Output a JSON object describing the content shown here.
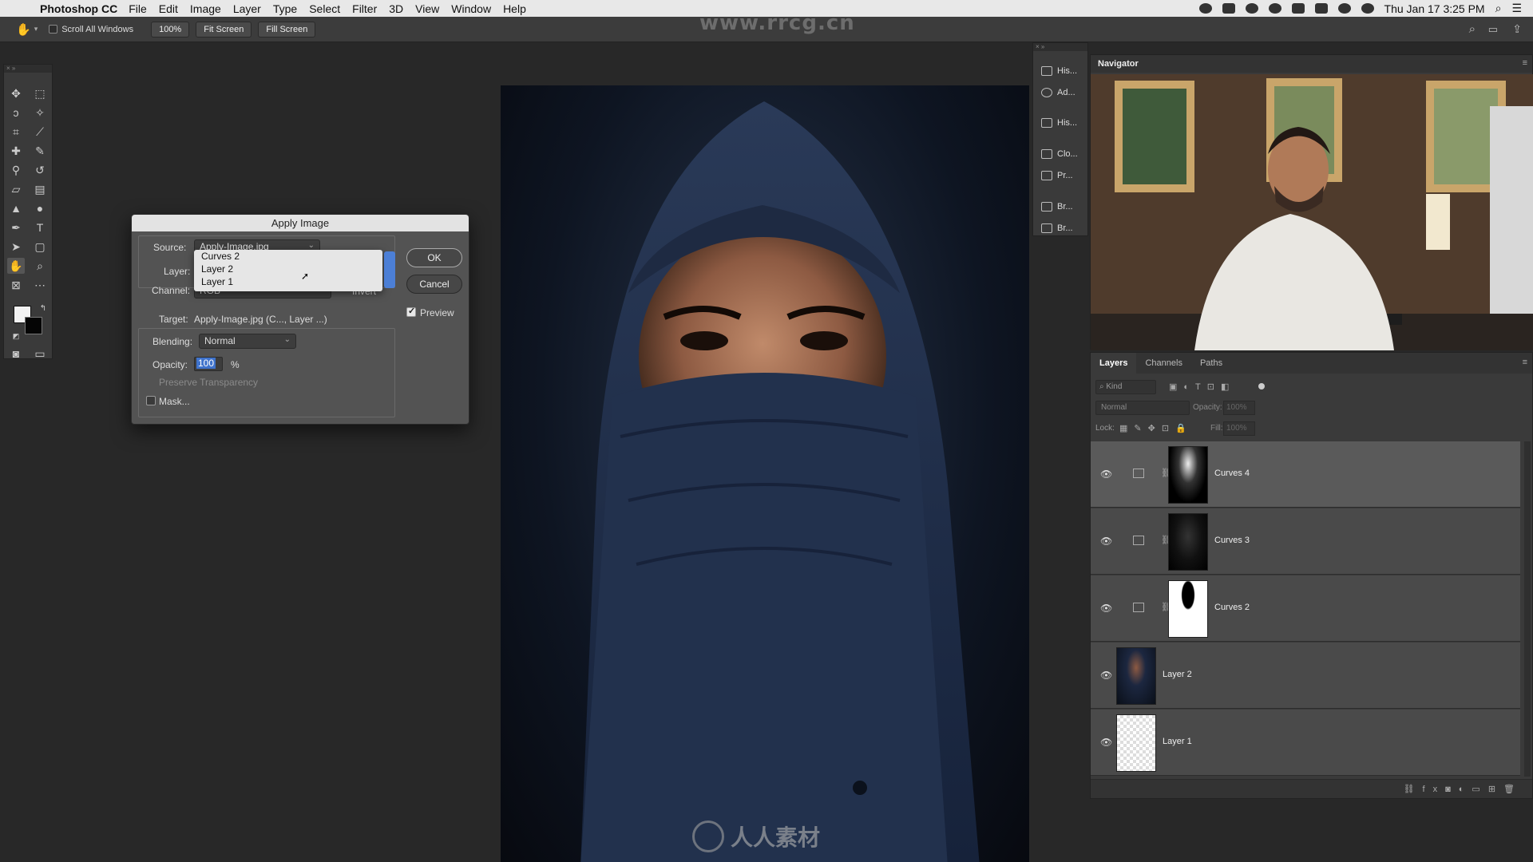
{
  "menubar": {
    "apple": "",
    "app_name": "Photoshop CC",
    "items": [
      "File",
      "Edit",
      "Image",
      "Layer",
      "Type",
      "Select",
      "Filter",
      "3D",
      "View",
      "Window",
      "Help"
    ],
    "clock": "Thu Jan 17  3:25 PM"
  },
  "options_bar": {
    "scroll_all_windows": "Scroll All Windows",
    "zoom": "100%",
    "fit_screen": "Fit Screen",
    "fill_screen": "Fill Screen"
  },
  "watermark": {
    "top": "www.rrcg.cn",
    "bottom": "人人素材"
  },
  "apply_image": {
    "title": "Apply Image",
    "source_label": "Source:",
    "source_value": "Apply-Image.jpg",
    "layer_label": "Layer:",
    "channel_label": "Channel:",
    "channel_value": "RGB",
    "invert_label": "Invert",
    "target_label": "Target:",
    "target_value": "Apply-Image.jpg (C..., Layer ...)",
    "blending_label": "Blending:",
    "blending_value": "Normal",
    "opacity_label": "Opacity:",
    "opacity_value": "100",
    "opacity_unit": "%",
    "preserve_label": "Preserve Transparency",
    "mask_label": "Mask...",
    "ok_label": "OK",
    "cancel_label": "Cancel",
    "preview_label": "Preview",
    "layer_options": [
      "Curves 2",
      "Layer 2",
      "Layer 1"
    ]
  },
  "mini_panel": {
    "items": [
      "His...",
      "Ad...",
      "His...",
      "Clo...",
      "Pr...",
      "Br...",
      "Br..."
    ]
  },
  "navigator": {
    "title": "Navigator"
  },
  "layers_panel": {
    "tabs": [
      "Layers",
      "Channels",
      "Paths"
    ],
    "kind": "Kind",
    "blend_mode": "Normal",
    "opacity_label": "Opacity:",
    "opacity_value": "100%",
    "lock_label": "Lock:",
    "fill_label": "Fill:",
    "fill_value": "100%",
    "layers": [
      {
        "name": "Curves 4"
      },
      {
        "name": "Curves 3"
      },
      {
        "name": "Curves 2"
      },
      {
        "name": "Layer 2"
      },
      {
        "name": "Layer 1"
      }
    ]
  },
  "colors": {
    "accent": "#4c7fd6"
  }
}
